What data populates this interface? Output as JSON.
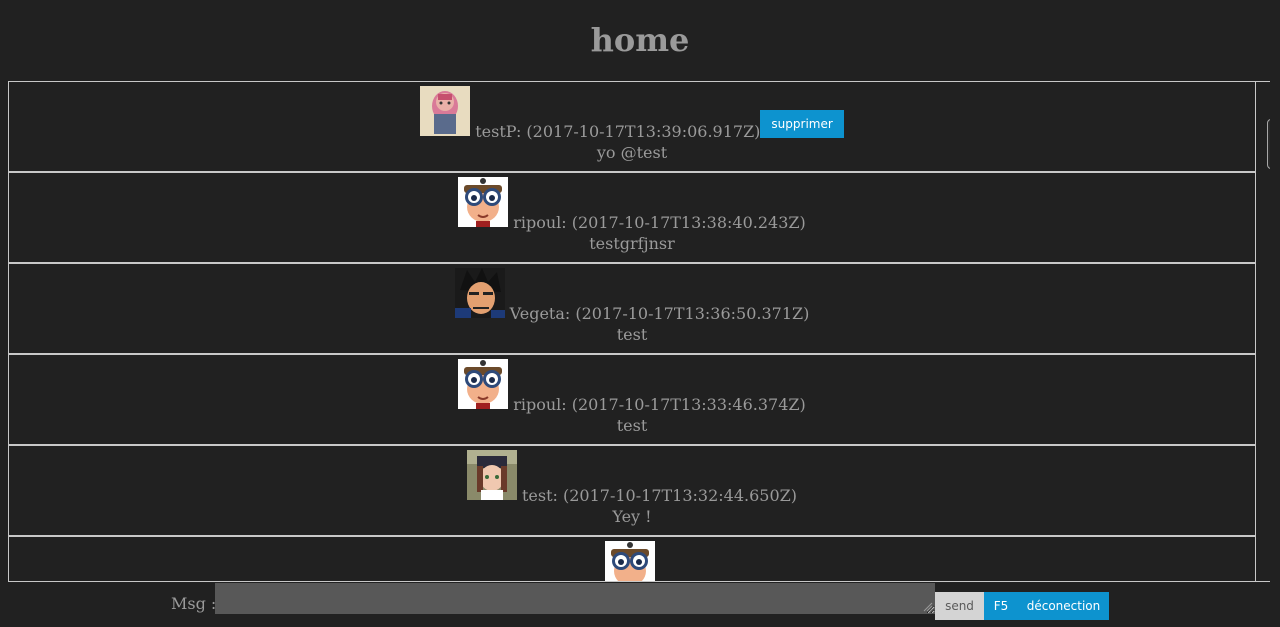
{
  "page": {
    "title": "home"
  },
  "messages": [
    {
      "author": "testP",
      "timestamp": "2017-10-17T13:39:06.917Z",
      "meta": "testP: (2017-10-17T13:39:06.917Z)",
      "text": "yo @test",
      "avatar": "pink-haired-character",
      "delete_label": "supprimer"
    },
    {
      "author": "ripoul",
      "timestamp": "2017-10-17T13:38:40.243Z",
      "meta": "ripoul: (2017-10-17T13:38:40.243Z)",
      "text": "testgrfjnsr",
      "avatar": "goggles-character"
    },
    {
      "author": "Vegeta",
      "timestamp": "2017-10-17T13:36:50.371Z",
      "meta": "Vegeta: (2017-10-17T13:36:50.371Z)",
      "text": "test",
      "avatar": "vegeta-character"
    },
    {
      "author": "ripoul",
      "timestamp": "2017-10-17T13:33:46.374Z",
      "meta": "ripoul: (2017-10-17T13:33:46.374Z)",
      "text": "test",
      "avatar": "goggles-character"
    },
    {
      "author": "test",
      "timestamp": "2017-10-17T13:32:44.650Z",
      "meta": "test: (2017-10-17T13:32:44.650Z)",
      "text": "Yey !",
      "avatar": "capped-girl-character"
    },
    {
      "author": "",
      "meta": "",
      "text": "",
      "avatar": "goggles-character"
    }
  ],
  "composer": {
    "label": "Msg :",
    "input_value": "",
    "send_label": "send",
    "refresh_label": "F5",
    "logout_label": "déconection"
  },
  "colors": {
    "background": "#212121",
    "text": "#9a9a9a",
    "accent": "#0d93cf",
    "border": "#c8c8c8",
    "input": "#585858"
  }
}
